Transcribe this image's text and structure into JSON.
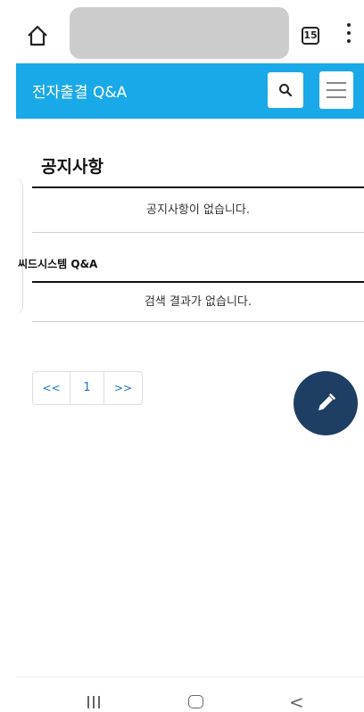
{
  "browser": {
    "tab_count": "15",
    "icons": {
      "home": "home-icon",
      "menu": "more-vertical-icon"
    }
  },
  "header": {
    "title": "전자출결 Q&A",
    "accent_color": "#1aa9e8",
    "icons": {
      "search": "search-icon",
      "menu": "hamburger-menu-icon"
    }
  },
  "notice": {
    "title": "공지사항",
    "empty_message": "공지사항이 없습니다."
  },
  "qa": {
    "caption": "씨드시스템 Q&A",
    "empty_message": "검색 결과가 없습니다."
  },
  "pagination": {
    "prev": "<<",
    "current": "1",
    "next": ">>"
  },
  "fab": {
    "icon": "pencil-icon",
    "color": "#1f3e63"
  },
  "nav": {
    "back": "<",
    "icons": {
      "recent": "recent-apps-icon",
      "home": "home-nav-icon",
      "back": "back-icon"
    }
  }
}
